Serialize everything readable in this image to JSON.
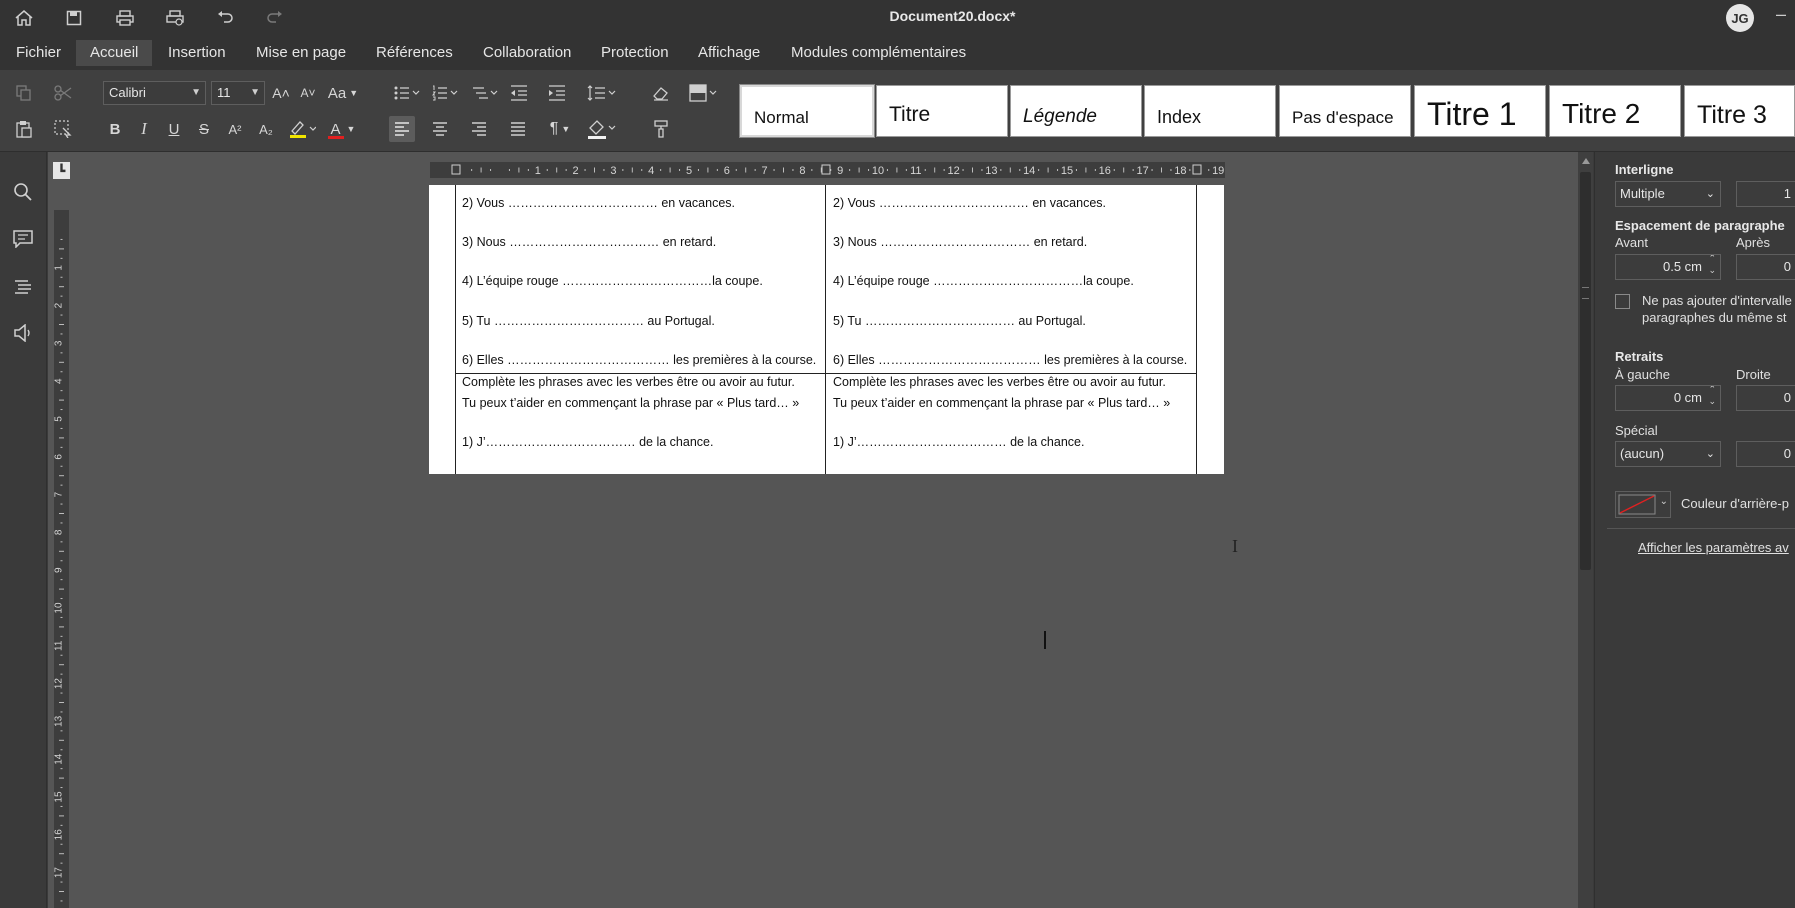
{
  "titlebar": {
    "title": "Document20.docx*",
    "user_initials": "JG",
    "minimize": "–"
  },
  "menu": [
    "Fichier",
    "Accueil",
    "Insertion",
    "Mise en page",
    "Références",
    "Collaboration",
    "Protection",
    "Affichage",
    "Modules complémentaires"
  ],
  "menu_active": "Accueil",
  "toolbar": {
    "font_name": "Calibri",
    "font_size": "11",
    "case_label": "Aa",
    "bold": "B",
    "italic": "I",
    "underline": "U",
    "strike": "S",
    "superscript": "A²",
    "subscript": "A₂",
    "grow_font": "A˄",
    "shrink_font": "A˅",
    "font_color_label": "A",
    "pilcrow": "¶"
  },
  "styles": [
    "Normal",
    "Titre",
    "Légende",
    "Index",
    "Pas d'espace",
    "Titre 1",
    "Titre 2",
    "Titre 3"
  ],
  "ruler_numbers": [
    "1",
    "2",
    "3",
    "4",
    "5",
    "6",
    "7",
    "8",
    "9",
    "10",
    "11",
    "12",
    "13",
    "14",
    "15",
    "16",
    "17",
    "18",
    "19"
  ],
  "vruler_numbers": [
    "1",
    "2",
    "3",
    "4",
    "5",
    "6",
    "7",
    "8",
    "9",
    "10",
    "11",
    "12",
    "13",
    "14",
    "15",
    "16",
    "17"
  ],
  "document": {
    "col1": {
      "lines_top": [
        "2) Vous ……………………………… en vacances.",
        "3) Nous ……………………………… en retard.",
        "4) L’équipe rouge ………………………………la coupe.",
        "5) Tu ……………………………… au Portugal.",
        "6) Elles ………………………………… les premières à la course."
      ],
      "instr1": "Complète les phrases avec les verbes être ou avoir au futur.",
      "instr2": "Tu peux t’aider en commençant la phrase par « Plus tard… »",
      "line_bottom": "1) J’……………………………… de la chance."
    },
    "col2": {
      "lines_top": [
        "2) Vous ……………………………… en vacances.",
        "3) Nous ……………………………… en retard.",
        "4) L’équipe rouge ………………………………la coupe.",
        "5) Tu ……………………………… au Portugal.",
        "6) Elles ………………………………… les premières à la course."
      ],
      "instr1": "Complète les phrases avec les verbes être ou avoir au futur.",
      "instr2": "Tu peux t’aider en commençant la phrase par « Plus tard… »",
      "line_bottom": "1) J’……………………………… de la chance."
    }
  },
  "right_panel": {
    "interligne": "Interligne",
    "interligne_value": "Multiple",
    "interligne_num": "1",
    "espacement": "Espacement de paragraphe",
    "avant": "Avant",
    "apres": "Après",
    "avant_value": "0.5 cm",
    "apres_value": "0",
    "no_space_line1": "Ne pas ajouter d'intervalle",
    "no_space_line2": "paragraphes du même st",
    "retraits": "Retraits",
    "gauche": "À gauche",
    "droite": "Droite",
    "gauche_value": "0 cm",
    "droite_value": "0",
    "special": "Spécial",
    "special_value": "(aucun)",
    "special_num": "0",
    "couleur": "Couleur d'arrière-p",
    "advanced": "Afficher les paramètres av"
  }
}
